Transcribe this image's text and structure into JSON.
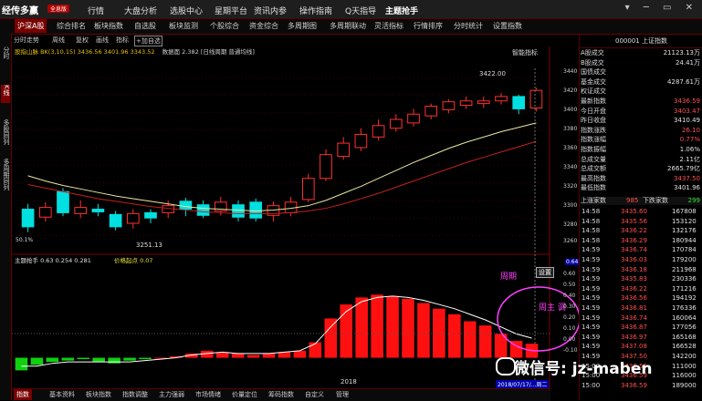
{
  "app": {
    "logo": "经传多赢",
    "logo_badge": "全息版",
    "main_menu": [
      "行情",
      "大盘分析",
      "选股中心",
      "星期平台",
      "资讯内参",
      "操作指南",
      "Q天指导",
      "主题抢手"
    ]
  },
  "window_controls": "▾ ─ ▭ ✕",
  "tabs": [
    "沪深A股",
    "综合排名",
    "板块指数",
    "自选股",
    "板块监测",
    "个股综合",
    "资金综合",
    "多周期图",
    "多周期联动",
    "灵活指标",
    "行情排序",
    "分时统计",
    "设置指数"
  ],
  "active_tab": 0,
  "sidebar": [
    "分时",
    "K线",
    "多股同列",
    "多周期同列"
  ],
  "sidebar_active": 1,
  "toolbar": [
    "分时走势",
    "周线",
    "复权",
    "画线",
    "指标",
    "+加自选"
  ],
  "legend_text": "股指山脉 BK(3,10,15)  3436.56  3401.96  3343.52",
  "legend_extra": "数据面 2.382  [日线周期 普通均线]",
  "price_axis": [
    "3440",
    "3420",
    "3400",
    "3380",
    "3360",
    "3340",
    "3320",
    "3300",
    "3280",
    "3260"
  ],
  "high_label": "3422.00",
  "low_label": "3251.13",
  "top_right_label": "智能指标",
  "bottom_left_label": "50.1%",
  "indicator": {
    "label": "主题抢手 0.63  0.254  0.281",
    "label2": "价格起点 0.07",
    "buttons": [
      "设置"
    ],
    "axis": [
      "0.60",
      "0.50",
      "0.40",
      "0.30",
      "0.20",
      "0.10",
      "0.00",
      "-0.10"
    ],
    "axis_top": "0.64",
    "annotation_zhouqi": "周期",
    "annotation_zhouqi2": "周主 调"
  },
  "x_axis": {
    "year_label": "2018",
    "date_label": "2018/07/17/...周二"
  },
  "info_panel": {
    "title": "000001 上证指数",
    "rows": [
      {
        "label": "A股成交",
        "value": "21123.13万",
        "color": "#e0e0e0"
      },
      {
        "label": "B股成交",
        "value": "24.41万",
        "color": "#e0e0e0"
      },
      {
        "label": "国债成交",
        "value": "",
        "color": "#e0e0e0"
      },
      {
        "label": "基金成交",
        "value": "4287.61万",
        "color": "#e0e0e0"
      },
      {
        "label": "权证成交",
        "value": "",
        "color": "#e0e0e0"
      },
      {
        "label": "最新指数",
        "value": "3436.59",
        "color": "#ff5050"
      },
      {
        "label": "今日开盘",
        "value": "3403.47",
        "color": "#ff5050"
      },
      {
        "label": "昨日收盘",
        "value": "3410.49",
        "color": "#e0e0e0"
      },
      {
        "label": "指数涨跌",
        "value": "26.10",
        "color": "#ff5050"
      },
      {
        "label": "指数涨幅",
        "value": "0.77%",
        "color": "#ff5050"
      },
      {
        "label": "指数振幅",
        "value": "1.06%",
        "color": "#e0e0e0"
      },
      {
        "label": "总成交量",
        "value": "2.11亿",
        "color": "#e0e0e0"
      },
      {
        "label": "总成交额",
        "value": "2665.79亿",
        "color": "#e0e0e0"
      },
      {
        "label": "最高指数",
        "value": "3437.50",
        "color": "#ff5050"
      },
      {
        "label": "最低指数",
        "value": "3401.96",
        "color": "#e0e0e0"
      }
    ],
    "updown": {
      "up_label": "上涨家数",
      "up": "985",
      "down_label": "下跌家数",
      "down": "299"
    }
  },
  "ticks": [
    {
      "time": "14:58",
      "price": "3435.60",
      "vol": "167808"
    },
    {
      "time": "14:58",
      "price": "3435.56",
      "vol": "153120"
    },
    {
      "time": "14:58",
      "price": "3436.22",
      "vol": "132176"
    },
    {
      "time": "14:58",
      "price": "3436.29",
      "vol": "180944"
    },
    {
      "time": "14:59",
      "price": "3436.74",
      "vol": "170784"
    },
    {
      "time": "14:59",
      "price": "3436.03",
      "vol": "179200"
    },
    {
      "time": "14:59",
      "price": "3436.18",
      "vol": "211968"
    },
    {
      "time": "14:59",
      "price": "3435.83",
      "vol": "230336"
    },
    {
      "time": "14:59",
      "price": "3436.22",
      "vol": "171216"
    },
    {
      "time": "14:59",
      "price": "3436.56",
      "vol": "194192"
    },
    {
      "time": "14:59",
      "price": "3436.81",
      "vol": "176336"
    },
    {
      "time": "14:59",
      "price": "3436.74",
      "vol": "160064"
    },
    {
      "time": "14:59",
      "price": "3436.87",
      "vol": "177056"
    },
    {
      "time": "14:59",
      "price": "3436.97",
      "vol": "165168"
    },
    {
      "time": "14:59",
      "price": "3437.08",
      "vol": "166528"
    },
    {
      "time": "14:59",
      "price": "3437.50",
      "vol": "142200"
    },
    {
      "time": "15:00",
      "price": "3436.59",
      "vol": "111000"
    },
    {
      "time": "15:00",
      "price": "3436.59",
      "vol": "116000"
    },
    {
      "time": "15:00",
      "price": "3436.59",
      "vol": "189000"
    }
  ],
  "bottom_tabs": [
    "指数",
    "基本资料",
    "板块指数",
    "指数调整",
    "主力强弱",
    "市场情绪",
    "价量定位",
    "筹码指数",
    "自定义",
    "管理"
  ],
  "bottom_active": 0,
  "watermark": "微信号: jz-maben",
  "chart_data": {
    "type": "candlestick",
    "candles": [
      {
        "o": 3290,
        "c": 3270,
        "h": 3296,
        "l": 3264
      },
      {
        "o": 3281,
        "c": 3292,
        "h": 3298,
        "l": 3276
      },
      {
        "o": 3310,
        "c": 3286,
        "h": 3314,
        "l": 3282
      },
      {
        "o": 3285,
        "c": 3292,
        "h": 3300,
        "l": 3280
      },
      {
        "o": 3290,
        "c": 3287,
        "h": 3296,
        "l": 3282
      },
      {
        "o": 3284,
        "c": 3270,
        "h": 3288,
        "l": 3266
      },
      {
        "o": 3274,
        "c": 3285,
        "h": 3290,
        "l": 3268
      },
      {
        "o": 3286,
        "c": 3280,
        "h": 3290,
        "l": 3274
      },
      {
        "o": 3286,
        "c": 3294,
        "h": 3300,
        "l": 3280
      },
      {
        "o": 3299,
        "c": 3290,
        "h": 3303,
        "l": 3282
      },
      {
        "o": 3295,
        "c": 3283,
        "h": 3300,
        "l": 3280
      },
      {
        "o": 3288,
        "c": 3298,
        "h": 3304,
        "l": 3283
      },
      {
        "o": 3295,
        "c": 3281,
        "h": 3300,
        "l": 3276
      },
      {
        "o": 3298,
        "c": 3280,
        "h": 3302,
        "l": 3276
      },
      {
        "o": 3283,
        "c": 3294,
        "h": 3299,
        "l": 3276
      },
      {
        "o": 3286,
        "c": 3298,
        "h": 3304,
        "l": 3282
      },
      {
        "o": 3301,
        "c": 3325,
        "h": 3330,
        "l": 3298
      },
      {
        "o": 3325,
        "c": 3352,
        "h": 3358,
        "l": 3322
      },
      {
        "o": 3350,
        "c": 3365,
        "h": 3372,
        "l": 3346
      },
      {
        "o": 3360,
        "c": 3375,
        "h": 3382,
        "l": 3356
      },
      {
        "o": 3372,
        "c": 3385,
        "h": 3392,
        "l": 3368
      },
      {
        "o": 3382,
        "c": 3392,
        "h": 3398,
        "l": 3378
      },
      {
        "o": 3388,
        "c": 3398,
        "h": 3404,
        "l": 3384
      },
      {
        "o": 3396,
        "c": 3407,
        "h": 3410,
        "l": 3392
      },
      {
        "o": 3403,
        "c": 3412,
        "h": 3415,
        "l": 3399
      },
      {
        "o": 3408,
        "c": 3413,
        "h": 3418,
        "l": 3404
      },
      {
        "o": 3410,
        "c": 3413,
        "h": 3418,
        "l": 3405
      },
      {
        "o": 3413,
        "c": 3418,
        "h": 3422,
        "l": 3409
      },
      {
        "o": 3418,
        "c": 3404,
        "h": 3420,
        "l": 3398
      },
      {
        "o": 3405,
        "c": 3425,
        "h": 3428,
        "l": 3401
      }
    ],
    "ma_fast": [
      3328,
      3322,
      3317,
      3313,
      3309,
      3305,
      3302,
      3299,
      3296,
      3293,
      3291,
      3290,
      3289,
      3288,
      3289,
      3291,
      3294,
      3300,
      3308,
      3316,
      3325,
      3334,
      3343,
      3351,
      3359,
      3366,
      3372,
      3378,
      3383,
      3388
    ],
    "ma_slow": [
      3318,
      3314,
      3310,
      3306,
      3302,
      3299,
      3296,
      3293,
      3291,
      3289,
      3287,
      3286,
      3285,
      3285,
      3285,
      3286,
      3288,
      3291,
      3296,
      3302,
      3308,
      3315,
      3322,
      3329,
      3336,
      3343,
      3349,
      3355,
      3361,
      3367
    ],
    "ylim": [
      3245,
      3450
    ],
    "indicator_bars": [
      -0.09,
      -0.05,
      -0.03,
      -0.02,
      -0.01,
      -0.03,
      -0.04,
      -0.02,
      -0.01,
      0.0,
      0.01,
      0.03,
      0.05,
      0.04,
      0.03,
      0.02,
      0.03,
      0.04,
      0.05,
      0.11,
      0.28,
      0.38,
      0.43,
      0.45,
      0.44,
      0.42,
      0.39,
      0.35,
      0.31,
      0.26,
      0.23,
      0.17,
      0.12,
      0.1
    ],
    "indicator_line": [
      -0.06,
      -0.06,
      -0.04,
      -0.03,
      -0.03,
      -0.03,
      -0.03,
      -0.03,
      -0.02,
      -0.01,
      0.0,
      0.02,
      0.03,
      0.04,
      0.03,
      0.03,
      0.03,
      0.04,
      0.05,
      0.1,
      0.22,
      0.33,
      0.4,
      0.43,
      0.44,
      0.43,
      0.41,
      0.38,
      0.35,
      0.31,
      0.27,
      0.22,
      0.17,
      0.14
    ],
    "indicator_ylim": [
      -0.12,
      0.66
    ]
  }
}
